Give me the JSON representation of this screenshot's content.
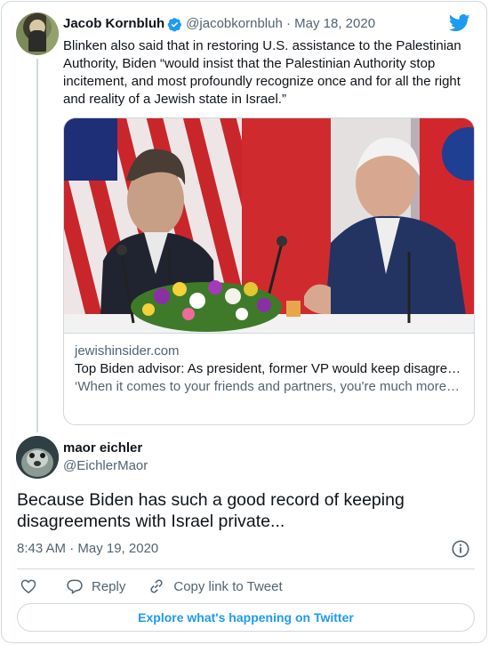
{
  "tweet": {
    "author_name": "Jacob Kornbluh",
    "author_handle": "@jacobkornbluh",
    "date": "May 18, 2020",
    "text": "Blinken also said that in restoring U.S. assistance to the Palestinian Authority, Biden “would insist that the Palestinian Authority stop incitement, and most profoundly recognize once and for all the right and reality of a Jewish state in Israel.”",
    "link_card": {
      "domain": "jewishinsider.com",
      "title": "Top Biden advisor: As president, former VP would keep disagre…",
      "description": "‘When it comes to your friends and partners, you're much more effective when you disagree on a policy matter in dealing with it…"
    }
  },
  "reply": {
    "author_name": "maor eichler",
    "author_handle": "@EichlerMaor",
    "text": "Because Biden has such a good record of keeping disagreements with Israel private...",
    "timestamp": "8:43 AM · May 19, 2020"
  },
  "actions": {
    "reply_label": "Reply",
    "copy_link_label": "Copy link to Tweet"
  },
  "explore_label": "Explore what's happening on Twitter",
  "colors": {
    "accent": "#1d9bf0",
    "secondary_text": "#536471",
    "border": "#cfd9de"
  },
  "icons": [
    "verified-badge-icon",
    "twitter-bird-icon",
    "info-icon",
    "heart-icon",
    "reply-icon",
    "link-icon"
  ]
}
